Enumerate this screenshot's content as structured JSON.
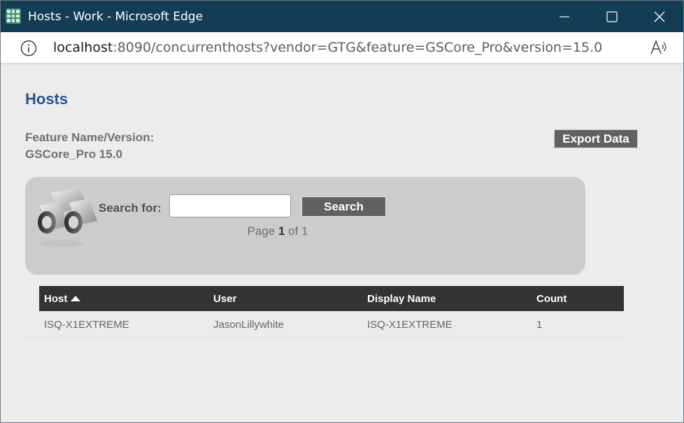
{
  "window": {
    "title": "Hosts - Work - Microsoft Edge"
  },
  "address_bar": {
    "url_host": "localhost",
    "url_rest": ":8090/concurrenthosts?vendor=GTG&feature=GSCore_Pro&version=15.0"
  },
  "page": {
    "title": "Hosts",
    "feature_label": "Feature Name/Version:",
    "feature_value": "GSCore_Pro 15.0",
    "export_button": "Export Data"
  },
  "search": {
    "label": "Search for:",
    "value": "",
    "placeholder": "",
    "button": "Search",
    "pager_prefix": "Page",
    "pager_current": "1",
    "pager_of": "of",
    "pager_total": "1"
  },
  "table": {
    "headers": [
      "Host",
      "User",
      "Display Name",
      "Count"
    ],
    "rows": [
      [
        "ISQ-X1EXTREME",
        "JasonLillywhite",
        "ISQ-X1EXTREME",
        "1"
      ]
    ]
  },
  "colors": {
    "title_bar": "#133d54",
    "page_title": "#2a5592",
    "button": "#616161",
    "table_header": "#333333"
  }
}
